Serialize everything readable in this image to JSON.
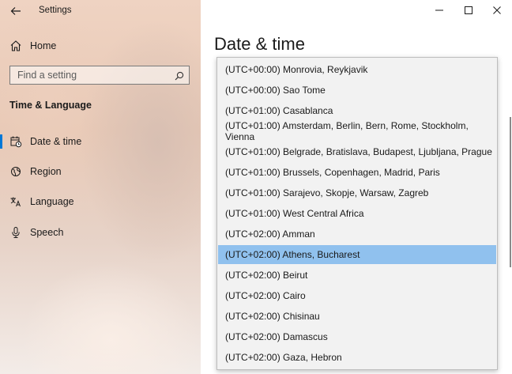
{
  "window": {
    "title": "Settings"
  },
  "sidebar": {
    "home_label": "Home",
    "search_placeholder": "Find a setting",
    "section_title": "Time & Language",
    "items": [
      {
        "label": "Date & time",
        "icon": "calendar-clock-icon",
        "selected": true
      },
      {
        "label": "Region",
        "icon": "globe-icon",
        "selected": false
      },
      {
        "label": "Language",
        "icon": "language-icon",
        "selected": false
      },
      {
        "label": "Speech",
        "icon": "microphone-icon",
        "selected": false
      }
    ]
  },
  "main": {
    "page_title": "Date & time",
    "timezone_dropdown": {
      "options": [
        "(UTC+00:00) Monrovia, Reykjavik",
        "(UTC+00:00) Sao Tome",
        "(UTC+01:00) Casablanca",
        "(UTC+01:00) Amsterdam, Berlin, Bern, Rome, Stockholm, Vienna",
        "(UTC+01:00) Belgrade, Bratislava, Budapest, Ljubljana, Prague",
        "(UTC+01:00) Brussels, Copenhagen, Madrid, Paris",
        "(UTC+01:00) Sarajevo, Skopje, Warsaw, Zagreb",
        "(UTC+01:00) West Central Africa",
        "(UTC+02:00) Amman",
        "(UTC+02:00) Athens, Bucharest",
        "(UTC+02:00) Beirut",
        "(UTC+02:00) Cairo",
        "(UTC+02:00) Chisinau",
        "(UTC+02:00) Damascus",
        "(UTC+02:00) Gaza, Hebron"
      ],
      "selected": "(UTC+02:00) Athens, Bucharest"
    }
  },
  "colors": {
    "accent": "#0078d7",
    "selection": "#90c1ee"
  }
}
